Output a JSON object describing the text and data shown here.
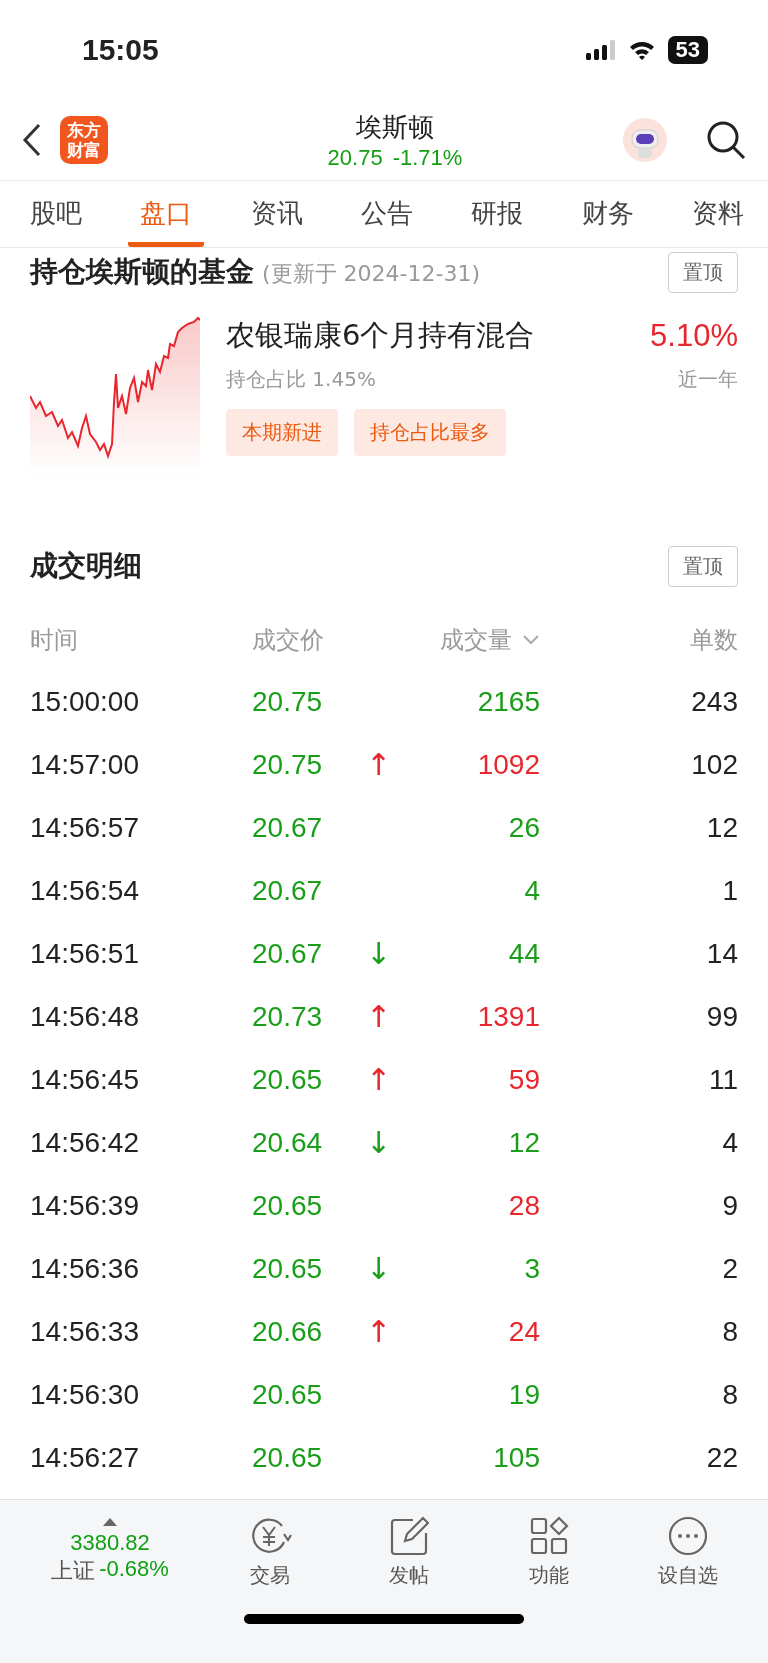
{
  "status_bar": {
    "time": "15:05",
    "battery": "53"
  },
  "header": {
    "logo": "东方财富",
    "title": "埃斯顿",
    "price": "20.75",
    "change": "-1.71%"
  },
  "tabs": [
    {
      "label": "股吧",
      "selected": false
    },
    {
      "label": "盘口",
      "selected": true
    },
    {
      "label": "资讯",
      "selected": false
    },
    {
      "label": "公告",
      "selected": false
    },
    {
      "label": "研报",
      "selected": false
    },
    {
      "label": "财务",
      "selected": false
    },
    {
      "label": "资料",
      "selected": false
    }
  ],
  "fund_section": {
    "title": "持仓埃斯顿的基金",
    "note": "(更新于 2024-12-31)",
    "pin_button": "置顶",
    "fund": {
      "name": "农银瑞康6个月持有混合",
      "return": "5.10%",
      "share": "持仓占比 1.45%",
      "period": "近一年",
      "tags": [
        "本期新进",
        "持仓占比最多"
      ]
    }
  },
  "trades": {
    "title": "成交明细",
    "pin_button": "置顶",
    "columns": [
      {
        "label": "时间",
        "sorted": false
      },
      {
        "label": "成交价",
        "sorted": false
      },
      {
        "label": "成交量",
        "sorted": true
      },
      {
        "label": "单数",
        "sorted": false
      }
    ],
    "rows": [
      {
        "time": "15:00:00",
        "price": "20.75",
        "volume": "2165",
        "color": "#1a9e1a",
        "count": "243"
      },
      {
        "time": "14:57:00",
        "price": "20.75",
        "arrow": "↑",
        "volume": "1092",
        "color": "#e8262d",
        "count": "102"
      },
      {
        "time": "14:56:57",
        "price": "20.67",
        "volume": "26",
        "color": "#1a9e1a",
        "count": "12"
      },
      {
        "time": "14:56:54",
        "price": "20.67",
        "volume": "4",
        "color": "#1a9e1a",
        "count": "1"
      },
      {
        "time": "14:56:51",
        "price": "20.67",
        "arrow": "↓",
        "volume": "44",
        "color": "#1a9e1a",
        "count": "14"
      },
      {
        "time": "14:56:48",
        "price": "20.73",
        "arrow": "↑",
        "volume": "1391",
        "color": "#e8262d",
        "count": "99"
      },
      {
        "time": "14:56:45",
        "price": "20.65",
        "arrow": "↑",
        "volume": "59",
        "color": "#e8262d",
        "count": "11"
      },
      {
        "time": "14:56:42",
        "price": "20.64",
        "arrow": "↓",
        "volume": "12",
        "color": "#1a9e1a",
        "count": "4"
      },
      {
        "time": "14:56:39",
        "price": "20.65",
        "volume": "28",
        "color": "#e8262d",
        "count": "9"
      },
      {
        "time": "14:56:36",
        "price": "20.65",
        "arrow": "↓",
        "volume": "3",
        "color": "#1a9e1a",
        "count": "2"
      },
      {
        "time": "14:56:33",
        "price": "20.66",
        "arrow": "↑",
        "volume": "24",
        "color": "#e8262d",
        "count": "8"
      },
      {
        "time": "14:56:30",
        "price": "20.65",
        "volume": "19",
        "color": "#1a9e1a",
        "count": "8"
      },
      {
        "time": "14:56:27",
        "price": "20.65",
        "volume": "105",
        "color": "#1a9e1a",
        "count": "22"
      }
    ]
  },
  "bottom_bar": {
    "index_value": "3380.82",
    "index_name": "上证",
    "index_change": "-0.68%",
    "items": [
      {
        "label": "交易"
      },
      {
        "label": "发帖"
      },
      {
        "label": "功能"
      },
      {
        "label": "设自选"
      }
    ]
  }
}
